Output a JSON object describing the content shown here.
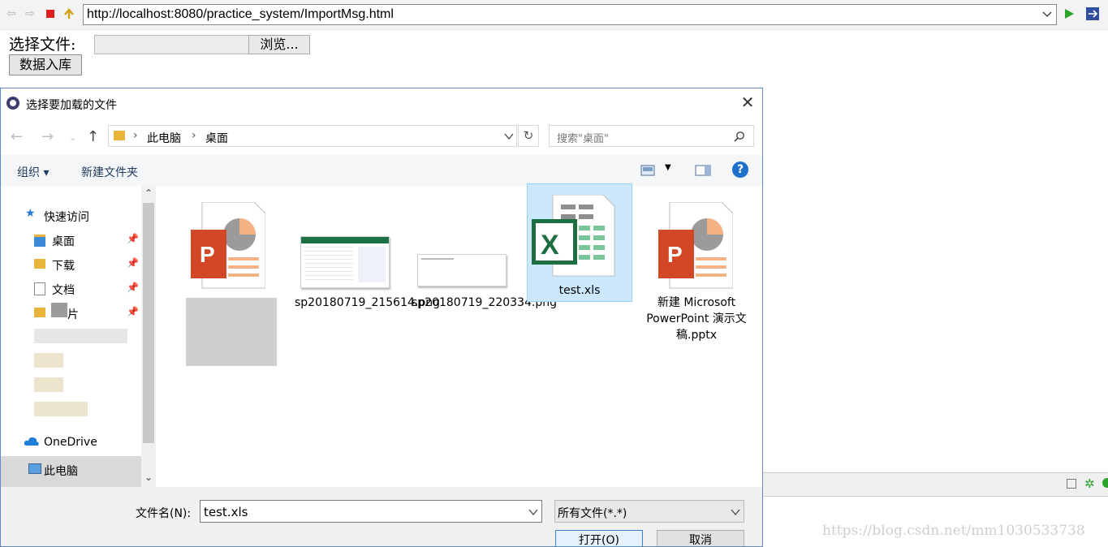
{
  "browser": {
    "url": "http://localhost:8080/practice_system/ImportMsg.html",
    "colors": {
      "stop": "#e02020",
      "go": "#2aa52a"
    }
  },
  "page": {
    "file_label": "选择文件:",
    "browse_button": "浏览...",
    "import_button": "数据入库"
  },
  "dialog": {
    "title": "选择要加载的文件",
    "breadcrumb": [
      "此电脑",
      "桌面"
    ],
    "search_placeholder": "搜索\"桌面\"",
    "toolbar": {
      "organize": "组织 ▾",
      "new_folder": "新建文件夹"
    },
    "nav": {
      "quick_access": "快速访问",
      "items": [
        {
          "label": "桌面",
          "pinned": true
        },
        {
          "label": "下载",
          "pinned": true
        },
        {
          "label": "文档",
          "pinned": true
        },
        {
          "label": "片",
          "pinned": true
        }
      ],
      "onedrive": "OneDrive",
      "this_pc": "此电脑"
    },
    "files": [
      {
        "name": "",
        "icon": "powerpoint-icon",
        "selected": false
      },
      {
        "name": "sp20180719_215614.png",
        "icon": "image-thumbnail",
        "selected": false
      },
      {
        "name": "sp20180719_220334.png",
        "icon": "image-thumbnail",
        "selected": false
      },
      {
        "name": "test.xls",
        "icon": "excel-icon",
        "selected": true
      },
      {
        "name": "新建 Microsoft PowerPoint 演示文稿.pptx",
        "icon": "powerpoint-icon",
        "selected": false
      }
    ],
    "footer": {
      "filename_label": "文件名(N):",
      "filename_value": "test.xls",
      "filetype_value": "所有文件(*.*)",
      "open_button": "打开(O)",
      "cancel_button": "取消"
    }
  },
  "watermark": "https://blog.csdn.net/mm1030533738"
}
